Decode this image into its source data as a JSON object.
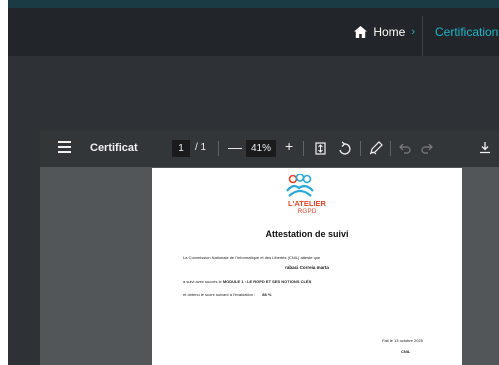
{
  "header": {
    "home_label": "Home",
    "chevron": "›",
    "current_label": "Certification"
  },
  "toolbar": {
    "title": "Certificat",
    "page_current": "1",
    "page_total": "/ 1",
    "zoom_minus": "—",
    "zoom_value": "41%",
    "zoom_plus": "+",
    "icons": [
      "menu-icon",
      "fit-page-icon",
      "rotate-icon",
      "annotate-icon",
      "undo-icon",
      "redo-icon",
      "download-icon"
    ]
  },
  "document": {
    "brand": "L'ATELIER",
    "brand_sub": "RGPD",
    "title": "Attestation de suivi",
    "line1": "La Commission Nationale de l'Informatique et des Libertés (CNIL) atteste que",
    "name": "rabaci Correia marta",
    "line2_prefix": "a suivi avec succès le",
    "line2_module": "MODULE 1 : LE RGPD ET SES NOTIONS CLÉS",
    "line3_prefix": "et obtenu le score suivant à l'évaluation :",
    "score": "88 %",
    "date": "Fait le 13 octobre 2025",
    "signatory": "CNIL"
  },
  "colors": {
    "accent": "#1fb4c8",
    "brand": "#e3462a",
    "logo_blue": "#2aa8d8"
  }
}
